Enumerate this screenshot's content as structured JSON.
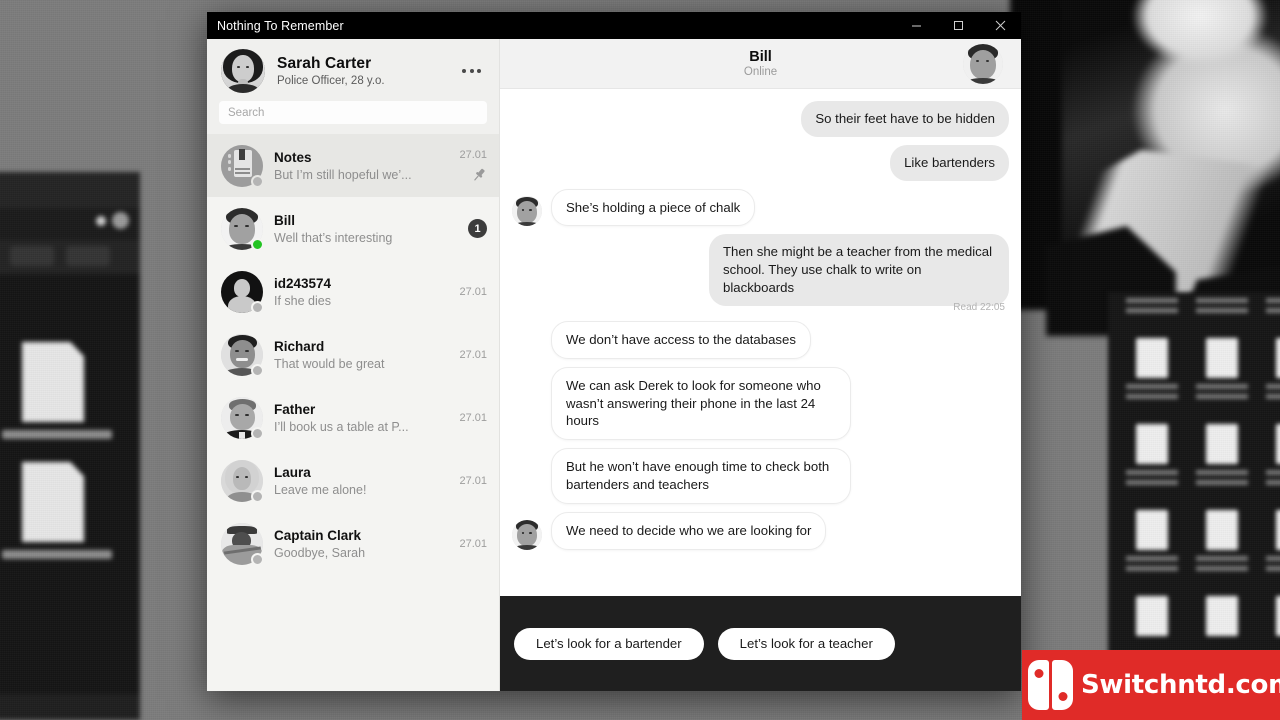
{
  "window": {
    "title": "Nothing To Remember",
    "controls": [
      {
        "name": "minimize",
        "label": "–"
      },
      {
        "name": "maximize",
        "label": "□"
      },
      {
        "name": "close",
        "label": "×"
      }
    ]
  },
  "sidebar": {
    "profile": {
      "name": "Sarah Carter",
      "subtitle": "Police Officer, 28 y.o.",
      "menu_icon": "more-options-icon"
    },
    "search": {
      "placeholder": "Search",
      "value": ""
    },
    "chats": [
      {
        "name": "Notes",
        "preview": "But I’m still hopeful we’...",
        "time": "27.01",
        "badge": "",
        "pinned": true,
        "online": false,
        "selected": true,
        "avatar": "notes"
      },
      {
        "name": "Bill",
        "preview": "Well that’s interesting",
        "time": "",
        "badge": "1",
        "pinned": false,
        "online": true,
        "selected": false,
        "avatar": "bill"
      },
      {
        "name": "id243574",
        "preview": "If she dies",
        "time": "27.01",
        "badge": "",
        "pinned": false,
        "online": false,
        "selected": false,
        "avatar": "anon"
      },
      {
        "name": "Richard",
        "preview": "That would be great",
        "time": "27.01",
        "badge": "",
        "pinned": false,
        "online": false,
        "selected": false,
        "avatar": "richard"
      },
      {
        "name": "Father",
        "preview": "I’ll book us a table at P...",
        "time": "27.01",
        "badge": "",
        "pinned": false,
        "online": false,
        "selected": false,
        "avatar": "father"
      },
      {
        "name": "Laura",
        "preview": "Leave me alone!",
        "time": "27.01",
        "badge": "",
        "pinned": false,
        "online": false,
        "selected": false,
        "avatar": "laura"
      },
      {
        "name": "Captain Clark",
        "preview": "Goodbye, Sarah",
        "time": "27.01",
        "badge": "",
        "pinned": false,
        "online": false,
        "selected": false,
        "avatar": "clark"
      }
    ]
  },
  "chat": {
    "header": {
      "name": "Bill",
      "status": "Online",
      "avatar": "bill"
    },
    "messages": [
      {
        "side": "out",
        "text": "So their feet have to be hidden",
        "avatar": false,
        "read": ""
      },
      {
        "side": "out",
        "text": "Like bartenders",
        "avatar": false,
        "read": ""
      },
      {
        "side": "in",
        "text": "She’s holding a piece of chalk",
        "avatar": true,
        "read": ""
      },
      {
        "side": "out",
        "text": "Then she might be a teacher from the medical school. They use chalk to write on blackboards",
        "avatar": false,
        "read": "Read 22:05"
      },
      {
        "side": "in",
        "text": "We don’t have access to the databases",
        "avatar": false,
        "read": ""
      },
      {
        "side": "in",
        "text": "We can ask Derek to look for someone who wasn’t answering their phone in the last 24 hours",
        "avatar": false,
        "read": ""
      },
      {
        "side": "in",
        "text": "But he won’t have enough time to check both bartenders and teachers",
        "avatar": false,
        "read": ""
      },
      {
        "side": "in",
        "text": "We need to decide who we are looking for",
        "avatar": true,
        "read": ""
      }
    ],
    "replies": [
      {
        "label": "Let’s look for a bartender"
      },
      {
        "label": "Let’s look for a teacher"
      }
    ]
  },
  "watermark": {
    "text": "Switchntd.com",
    "color": "#e02b28",
    "logo_icon": "switch-console-icon"
  },
  "colors": {
    "titlebar": "#000000",
    "sidebar": "#f0f0ee",
    "chatlist": "#f4f4f2",
    "selected_row": "#e7e7e4",
    "bubble_out": "#e8e8e8",
    "bubble_in": "#ffffff",
    "reply_bar": "#1f1f1f",
    "online": "#23c423",
    "badge": "#3c3c3c"
  }
}
